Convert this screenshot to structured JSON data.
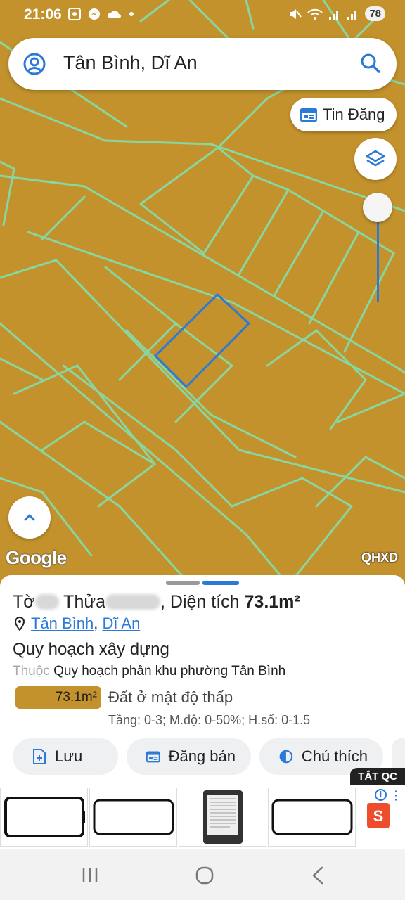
{
  "status_bar": {
    "time": "21:06",
    "battery": "78",
    "icons_left": [
      "screenshot-icon",
      "messenger-icon",
      "cloud-icon",
      "dot-icon"
    ],
    "icons_right": [
      "mute-icon",
      "wifi-icon",
      "signal-icon",
      "signal-icon"
    ]
  },
  "search": {
    "query": "Tân Bình, Dĩ An",
    "left_icon": "user-circle-icon",
    "right_icon": "search-icon"
  },
  "map": {
    "tin_dang_label": "Tin Đăng",
    "google_label": "Google",
    "layer_label": "QHXD",
    "zoom_level": 1.0,
    "colors": {
      "land": "#c4922c",
      "parcel_lines": "#88d6a0",
      "selected": "#2b7ad8"
    }
  },
  "parcel": {
    "prefix": "Tờ",
    "thua": "Thửa",
    "area_sep": ", Diện tích",
    "area_value": "73.1m²",
    "location_a": "Tân Bình",
    "location_sep": ",",
    "location_b": "Dĩ An",
    "section_title": "Quy hoạch xây dựng",
    "belongs_label": "Thuộc",
    "belongs_value": "Quy hoạch phân khu phường Tân Bình",
    "chip_area": "73.1m²",
    "land_type": "Đất ở mật độ thấp",
    "params": "Tầng: 0-3; M.độ: 0-50%; H.số: 0-1.5"
  },
  "actions": {
    "save": "Lưu",
    "sell": "Đăng bán",
    "legend": "Chú thích"
  },
  "ad": {
    "close_label": "TẮT QC",
    "shop_glyph": "S",
    "info_glyph": "i"
  }
}
